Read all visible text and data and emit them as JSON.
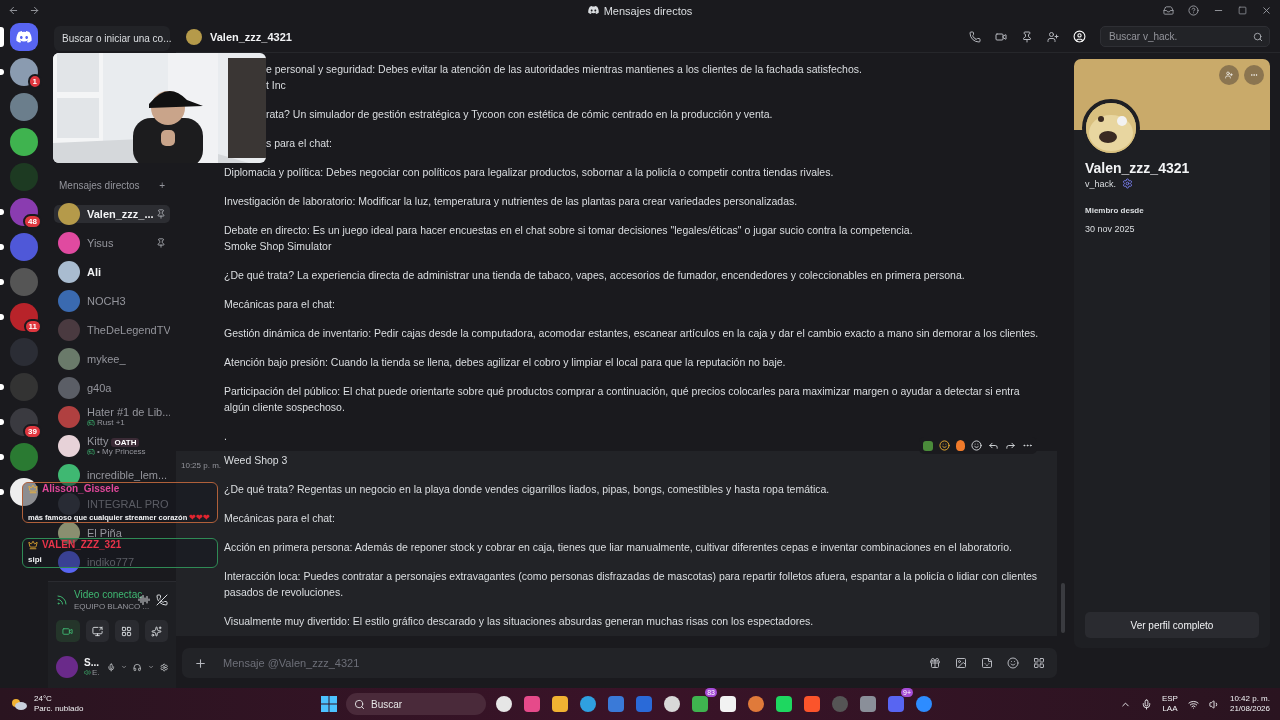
{
  "title_bar": {
    "title": "Mensajes directos"
  },
  "servers": [
    {
      "kind": "home",
      "unread": true
    },
    {
      "kind": "server",
      "unread": true,
      "badge": "1"
    },
    {
      "kind": "server",
      "unread": false
    },
    {
      "kind": "server",
      "unread": false
    },
    {
      "kind": "server",
      "unread": false
    },
    {
      "kind": "server",
      "unread": true,
      "badge": "48"
    },
    {
      "kind": "server",
      "unread": true
    },
    {
      "kind": "server",
      "unread": true
    },
    {
      "kind": "server",
      "unread": true,
      "badge": "11"
    },
    {
      "kind": "server",
      "unread": false
    },
    {
      "kind": "server",
      "unread": true
    },
    {
      "kind": "server",
      "unread": true,
      "badge": "39"
    },
    {
      "kind": "server",
      "unread": true
    },
    {
      "kind": "server",
      "unread": true
    }
  ],
  "dm_search": {
    "label": "Buscar o iniciar una co..."
  },
  "dm_header": {
    "label": "Mensajes directos",
    "add": "+"
  },
  "dms": [
    {
      "name": "Valen_zzz_...",
      "selected": true,
      "unread": false,
      "pinned": true
    },
    {
      "name": "Yisus",
      "selected": false,
      "unread": false,
      "pinned": true
    },
    {
      "name": "Ali",
      "selected": false,
      "unread": true,
      "pinned": false
    },
    {
      "name": "NOCH3",
      "selected": false,
      "unread": false,
      "pinned": false
    },
    {
      "name": "TheDeLegendTV",
      "selected": false,
      "unread": false,
      "pinned": false
    },
    {
      "name": "mykee_",
      "selected": false,
      "unread": false,
      "pinned": false
    },
    {
      "name": "g40a",
      "selected": false,
      "unread": false,
      "pinned": false
    },
    {
      "name": "Hater #1 de Lib...",
      "selected": false,
      "unread": false,
      "pinned": false,
      "activity": "Rust +1"
    },
    {
      "name": "Kitty",
      "selected": false,
      "unread": false,
      "pinned": false,
      "tag": "OATH",
      "activity": "• My Princess"
    },
    {
      "name": "incredible_lem...",
      "selected": false,
      "unread": false,
      "pinned": false
    },
    {
      "name": "INTEGRAL PRO",
      "selected": false,
      "unread": false,
      "pinned": false
    },
    {
      "name": "El Piña",
      "selected": false,
      "unread": false,
      "pinned": false
    },
    {
      "name": "indiko777",
      "selected": false,
      "unread": false,
      "pinned": false
    }
  ],
  "voice": {
    "status": "Video conectac",
    "channel": "EQUIPO BLANCO ..."
  },
  "user": {
    "name": "S...",
    "status": "E."
  },
  "header": {
    "name": "Valen_zzz_4321",
    "search_placeholder": "Buscar v_hack."
  },
  "messages": [
    {
      "text": "e personal y seguridad: Debes evitar la atención de las autoridades mientras mantienes a los clientes de la fachada satisfechos.\nt Inc",
      "covered": true
    },
    {
      "text": "rata? Un simulador de gestión estratégica y Tycoon con estética de cómic centrado en la producción y venta.",
      "covered": true
    },
    {
      "text": "s para el chat:",
      "covered": true
    },
    {
      "text": "Diplomacia y política: Debes negociar con políticos para legalizar productos, sobornar a la policía o competir contra tiendas rivales.",
      "covered": false
    },
    {
      "text": "Investigación de laboratorio: Modificar la luz, temperatura y nutrientes de las plantas para crear variedades personalizadas.",
      "covered": false
    },
    {
      "text": "Debate en directo: Es un juego ideal para hacer encuestas en el chat sobre si tomar decisiones \"legales/éticas\" o jugar sucio contra la competencia.\nSmoke Shop Simulator",
      "covered": false
    },
    {
      "text": "¿De qué trata? La experiencia directa de administrar una tienda de tabaco, vapes, accesorios de fumador, encendedores y coleccionables en primera persona.",
      "covered": false
    },
    {
      "text": "Mecánicas para el chat:",
      "covered": false
    },
    {
      "text": "Gestión dinámica de inventario: Pedir cajas desde la computadora, acomodar estantes, escanear artículos en la caja y dar el cambio exacto a mano sin demorar a los clientes.",
      "covered": false
    },
    {
      "text": "Atención bajo presión: Cuando la tienda se llena, debes agilizar el cobro y limpiar el local para que la reputación no baje.",
      "covered": false
    },
    {
      "text": "Participación del público: El chat puede orientarte sobre qué productos comprar a continuación, qué precios colocarles para maximizar margen o ayudar a detectar si entra algún cliente sospechoso.",
      "covered": false
    },
    {
      "text": ".",
      "covered": false
    }
  ],
  "hovered_message": {
    "time": "10:25 p. m.",
    "paragraphs": [
      "Weed Shop 3",
      "¿De qué trata? Regentas un negocio en la playa donde vendes cigarrillos liados, pipas, bongs, comestibles y hasta ropa temática.",
      "Mecánicas para el chat:",
      "Acción en primera persona: Además de reponer stock y cobrar en caja, tienes que liar manualmente, cultivar diferentes cepas e inventar combinaciones en el laboratorio.",
      "Interacción loca: Puedes contratar a personajes extravagantes (como personas disfrazadas de mascotas) para repartir folletos afuera, espantar a la policía o lidiar con clientes pasados de revoluciones.",
      "Visualmente muy divertido: El estilo gráfico descarado y las situaciones absurdas generan muchas risas con los espectadores."
    ]
  },
  "composer": {
    "placeholder": "Mensaje @Valen_zzz_4321"
  },
  "profile": {
    "name": "Valen_zzz_4321",
    "username": "v_hack.",
    "member_label": "Miembro desde",
    "member_since": "30 nov 2025",
    "button": "Ver perfil completo"
  },
  "stream_chat": [
    {
      "user": "Alisson_Gissele",
      "color": "#e0479a",
      "text": "más famoso que cualquier streamer corazón",
      "emotes": "❤❤❤"
    },
    {
      "user": "VALEN_ZZZ_321",
      "color": "#e8344a",
      "text": "sipi"
    }
  ],
  "taskbar": {
    "temperature": "24°C",
    "weather": "Parc. nublado",
    "search": "Buscar",
    "apps": [
      {
        "kind": "app"
      },
      {
        "kind": "app"
      },
      {
        "kind": "app"
      },
      {
        "kind": "app"
      },
      {
        "kind": "app"
      },
      {
        "kind": "app"
      },
      {
        "kind": "app"
      },
      {
        "kind": "app",
        "badge": "83"
      },
      {
        "kind": "app"
      },
      {
        "kind": "app"
      },
      {
        "kind": "app"
      },
      {
        "kind": "app"
      },
      {
        "kind": "app"
      },
      {
        "kind": "app"
      },
      {
        "kind": "app",
        "badge": "9+"
      },
      {
        "kind": "app"
      }
    ],
    "language": "ESP",
    "layout": "LAA",
    "time": "10:42 p. m.",
    "date": "21/08/2026"
  }
}
